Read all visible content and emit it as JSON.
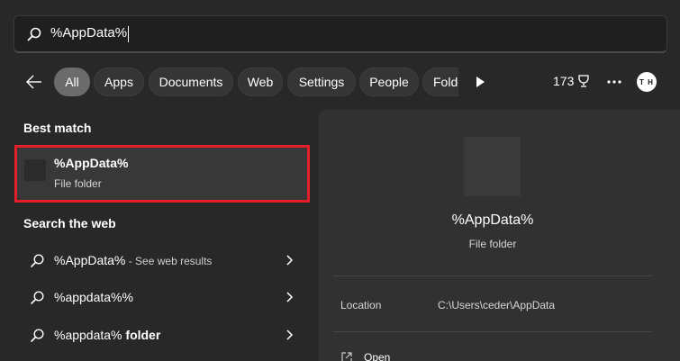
{
  "search": {
    "value": "%AppData%",
    "icon": "search-icon"
  },
  "filters": {
    "back_icon": "back-arrow-icon",
    "chips": [
      {
        "label": "All",
        "active": true
      },
      {
        "label": "Apps"
      },
      {
        "label": "Documents"
      },
      {
        "label": "Web"
      },
      {
        "label": "Settings"
      },
      {
        "label": "People"
      },
      {
        "label": "Folde"
      }
    ],
    "play_icon": "play-icon",
    "points": "173",
    "points_icon": "trophy-icon",
    "more_icon": "more-icon",
    "avatar_initials": "T H"
  },
  "best_match": {
    "heading": "Best match",
    "name": "%AppData%",
    "type": "File folder",
    "highlight_color": "#e51f2a"
  },
  "web": {
    "heading": "Search the web",
    "results": [
      {
        "query": "%AppData%",
        "suffix": " - See web results"
      },
      {
        "query": "%appdata%%",
        "suffix": ""
      },
      {
        "query": "%appdata% folder",
        "suffix": "",
        "bold_part": "folder",
        "base": "%appdata% "
      }
    ]
  },
  "preview": {
    "title": "%AppData%",
    "type": "File folder",
    "location_label": "Location",
    "location_value": "C:\\Users\\ceder\\AppData",
    "open_label": "Open"
  }
}
